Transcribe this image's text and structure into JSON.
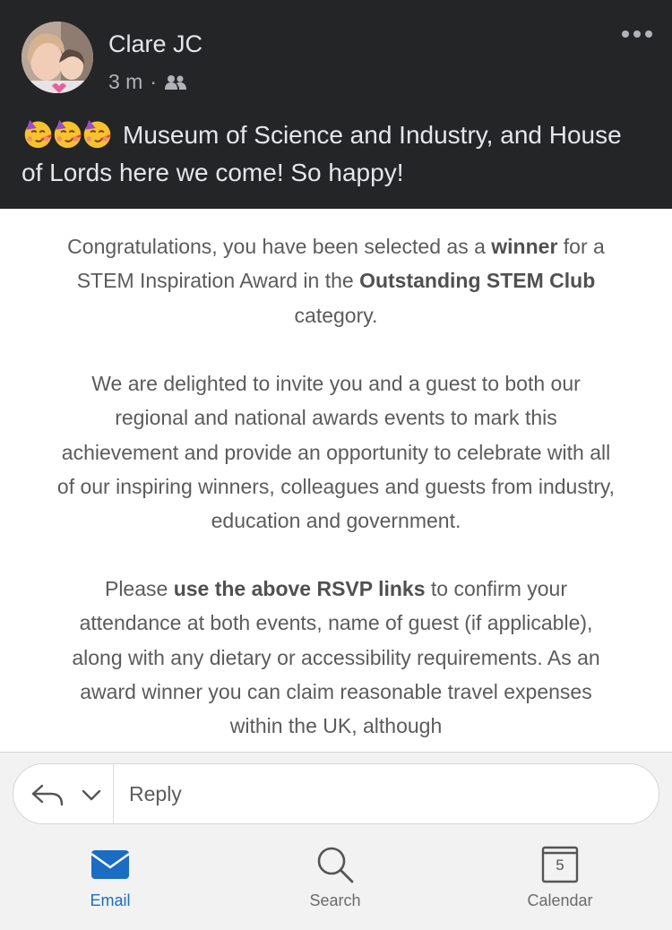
{
  "post": {
    "author": "Clare JC",
    "time": "3 m",
    "separator": "·",
    "audience_icon": "friends-icon",
    "text": "Museum of Science and Industry, and House of Lords here we come! So happy!",
    "emoji": [
      "partying-face",
      "partying-face",
      "partying-face"
    ],
    "more_icon": "more-options-icon"
  },
  "email": {
    "p1": {
      "t1": "Congratulations, you have been selected as a ",
      "b1": "winner",
      "t2": " for a STEM Inspiration Award in the ",
      "b2": "Outstanding STEM Club",
      "t3": " category."
    },
    "p2": "We are delighted to invite you and a guest to both our regional and national awards events to mark this achievement and provide an opportunity to celebrate with all of our inspiring winners, colleagues and guests from industry, education and government.",
    "p3": {
      "t1": "Please ",
      "b1": "use the above RSVP links",
      "t2": " to confirm your attendance at both events, name of guest (if applicable), along with any dietary or accessibility requirements. As an award winner you can claim reasonable travel expenses within the UK, although"
    }
  },
  "reply": {
    "label": "Reply",
    "icon": "reply-arrow-icon",
    "chevron": "chevron-down-icon"
  },
  "tabs": [
    {
      "label": "Email",
      "icon": "mail-icon",
      "active": true
    },
    {
      "label": "Search",
      "icon": "search-icon",
      "active": false
    },
    {
      "label": "Calendar",
      "icon": "calendar-icon",
      "active": false,
      "day": "5"
    }
  ],
  "colors": {
    "post_bg": "#242526",
    "accent": "#1b6cc3",
    "tabbar_bg": "#f2f2f2"
  }
}
